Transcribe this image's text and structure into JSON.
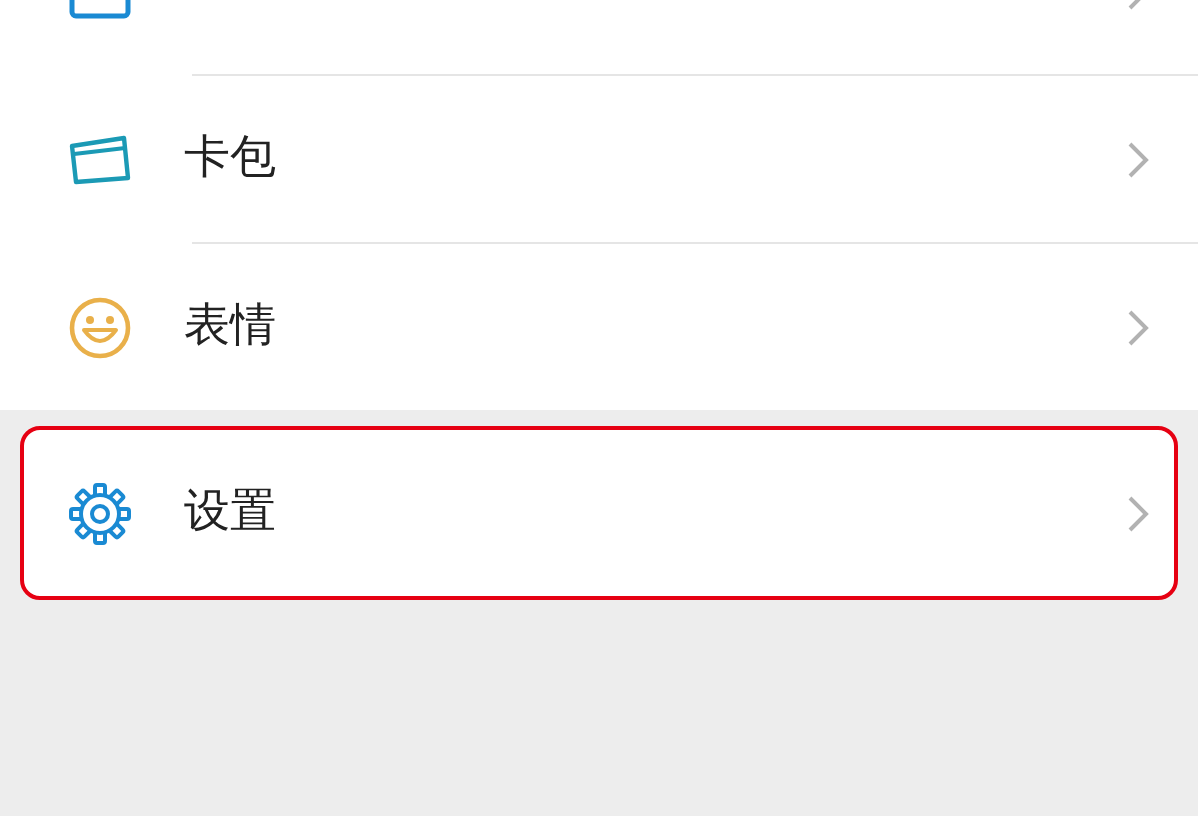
{
  "groups": [
    {
      "items": [
        {
          "kind": "moments",
          "cut_off": true
        },
        {
          "kind": "cards",
          "label": "卡包",
          "highlighted": false
        },
        {
          "kind": "emoji",
          "label": "表情",
          "highlighted": false
        }
      ]
    },
    {
      "items": [
        {
          "kind": "settings",
          "label": "设置",
          "highlighted": true
        }
      ]
    }
  ]
}
